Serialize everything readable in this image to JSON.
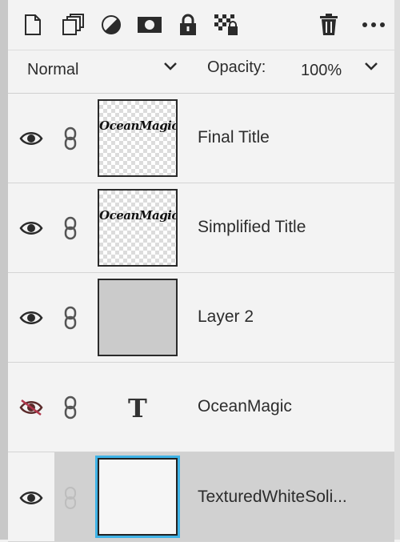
{
  "toolbar": {
    "icons": [
      "new-layer-icon",
      "duplicate-layer-icon",
      "adjustment-layer-icon",
      "layer-mask-icon",
      "lock-layer-icon",
      "lock-transparency-icon",
      "delete-layer-icon",
      "more-options-icon"
    ]
  },
  "blend": {
    "mode": "Normal",
    "opacity_label": "Opacity:",
    "opacity_value": "100%"
  },
  "layers": [
    {
      "name": "Final Title",
      "visible": true,
      "thumb_text": "OceanMagic"
    },
    {
      "name": "Simplified Title",
      "visible": true,
      "thumb_text": "OceanMagic"
    },
    {
      "name": "Layer 2",
      "visible": true
    },
    {
      "name": "OceanMagic",
      "visible": false,
      "thumb_glyph": "T"
    },
    {
      "name": "TexturedWhiteSoli...",
      "visible": true,
      "selected": true
    }
  ],
  "colors": {
    "selection_outline": "#3fb3e6",
    "selected_row": "#d1d1d1",
    "panel_bg": "#f3f3f3"
  }
}
